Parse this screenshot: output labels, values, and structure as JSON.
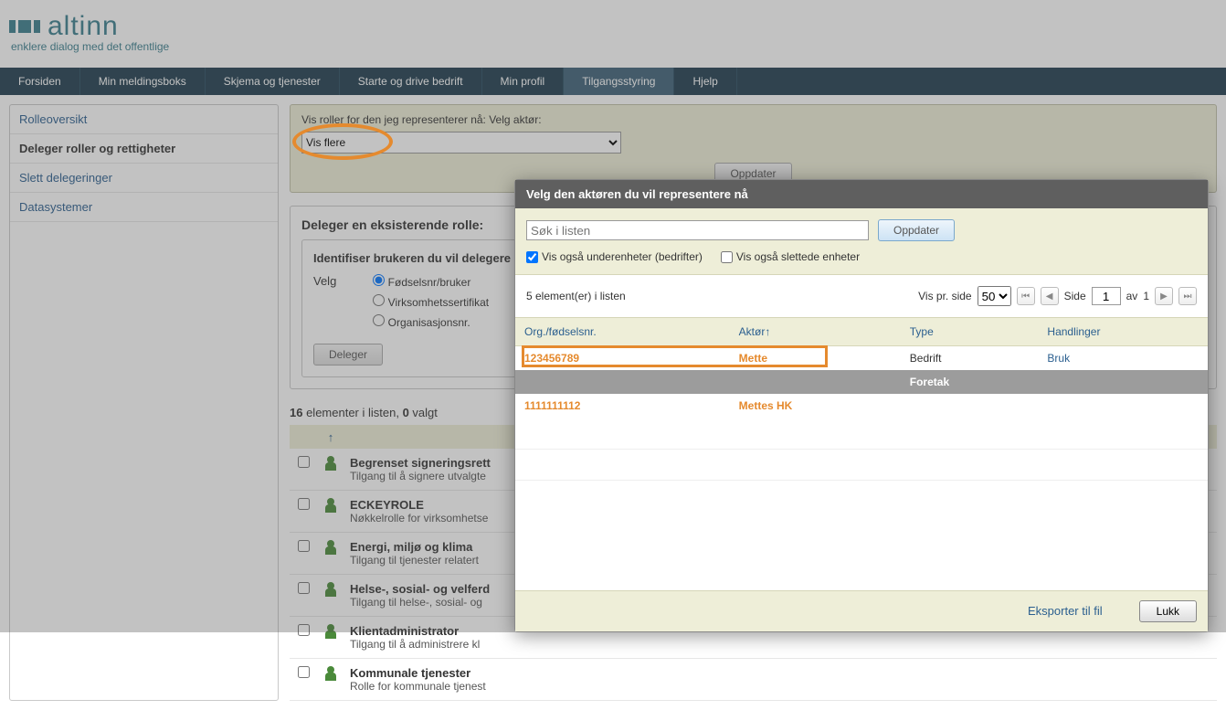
{
  "logo_text": "altinn",
  "tagline": "enklere dialog med det offentlige",
  "nav": [
    "Forsiden",
    "Min meldingsboks",
    "Skjema og tjenester",
    "Starte og drive bedrift",
    "Min profil",
    "Tilgangsstyring",
    "Hjelp"
  ],
  "nav_active_index": 5,
  "sidebar": [
    {
      "label": "Rolleoversikt"
    },
    {
      "label": "Deleger roller og rettigheter",
      "active": true
    },
    {
      "label": "Slett delegeringer"
    },
    {
      "label": "Datasystemer"
    }
  ],
  "top_controls": {
    "label": "Vis roller for den jeg representerer nå: Velg aktør:",
    "select_value": "Vis flere",
    "update_btn": "Oppdater"
  },
  "panel": {
    "title": "Deleger en eksisterende rolle:",
    "inner_title": "Identifiser brukeren du vil delegere",
    "velg_label": "Velg",
    "radios": [
      "Fødselsnr/bruker",
      "Virksomhetssertifikat",
      "Organisasjonsnr."
    ],
    "deleger_btn": "Deleger"
  },
  "list_meta": {
    "count": "16",
    "text": " elementer i listen, ",
    "selected": "0",
    "selected_text": " valgt"
  },
  "roles": [
    {
      "title": "Begrenset signeringsrett",
      "desc": "Tilgang til å signere utvalgte"
    },
    {
      "title": "ECKEYROLE",
      "desc": "Nøkkelrolle for virksomhetse"
    },
    {
      "title": "Energi, miljø og klima",
      "desc": "Tilgang til tjenester relatert"
    },
    {
      "title": "Helse-, sosial- og velferd",
      "desc": "Tilgang til helse-, sosial- og"
    },
    {
      "title": "Klientadministrator",
      "desc": "Tilgang til å administrere kl"
    },
    {
      "title": "Kommunale tjenester",
      "desc": "Rolle for kommunale tjenest"
    }
  ],
  "dialog": {
    "title": "Velg den aktøren du vil representere nå",
    "search_placeholder": "Søk i listen",
    "search_btn": "Oppdater",
    "cb1": "Vis også underenheter (bedrifter)",
    "cb2": "Vis også slettede enheter",
    "meta_count": "5 element(er) i listen",
    "per_page_label": "Vis pr. side",
    "per_page_value": "50",
    "page_label": "Side",
    "page_value": "1",
    "page_of": "av",
    "page_total": "1",
    "columns": {
      "org": "Org./fødselsnr.",
      "aktor": "Aktør",
      "type": "Type",
      "actions": "Handlinger"
    },
    "rows": [
      {
        "org": "123456789",
        "aktor": "Mette",
        "type": "Bedrift",
        "action": "Bruk",
        "class": "bedrift"
      },
      {
        "org": "",
        "aktor": "",
        "type": "Foretak",
        "action": "",
        "class": "foretak"
      },
      {
        "org": "1111111112",
        "aktor": "Mettes HK",
        "type": "",
        "action": "",
        "class": "bedrift"
      }
    ],
    "export": "Eksporter til fil",
    "close": "Lukk"
  }
}
